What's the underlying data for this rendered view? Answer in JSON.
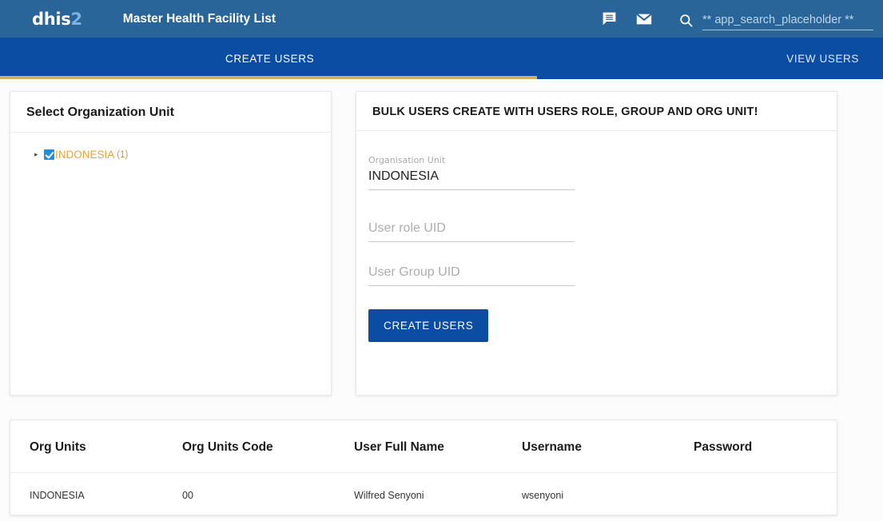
{
  "header": {
    "brand_main": "dhis",
    "brand_accent": "2",
    "app_title": "Master Health Facility List",
    "icons": {
      "messages": "message-bubble-icon",
      "mail": "mail-envelope-icon",
      "search": "search-icon"
    },
    "search_placeholder": "** app_search_placeholder **",
    "search_value": ""
  },
  "nav": {
    "tabs": [
      {
        "label": "CREATE USERS",
        "active": true
      },
      {
        "label": "VIEW USERS",
        "active": false
      }
    ],
    "active_underline_color": "#d2ab67"
  },
  "org_panel": {
    "title": "Select Organization Unit",
    "tree": [
      {
        "label": "INDONESIA",
        "count": "(1)",
        "checked": true,
        "expandable": true
      }
    ]
  },
  "bulk_panel": {
    "title": "BULK USERS CREATE WITH USERS ROLE, GROUP AND ORG UNIT!",
    "fields": [
      {
        "label": "Organisation Unit",
        "value": "INDONESIA",
        "placeholder": ""
      },
      {
        "label": "",
        "value": "",
        "placeholder": "User role UID"
      },
      {
        "label": "",
        "value": "",
        "placeholder": "User Group UID"
      }
    ],
    "submit_label": "CREATE USERS"
  },
  "table": {
    "columns": [
      "Org Units",
      "Org Units Code",
      "User Full Name",
      "Username",
      "Password"
    ],
    "rows": [
      {
        "org_unit": "INDONESIA",
        "org_unit_code": "00",
        "full_name": "Wilfred Senyoni",
        "username": "wsenyoni",
        "password": ""
      }
    ]
  },
  "colors": {
    "header_blue": "#2a6599",
    "nav_blue": "#0a4da2",
    "accent_gold": "#d2ab67",
    "tree_orange": "#e8a33d",
    "button_blue": "#0b4da2",
    "page_bg": "#fcfcfc"
  }
}
